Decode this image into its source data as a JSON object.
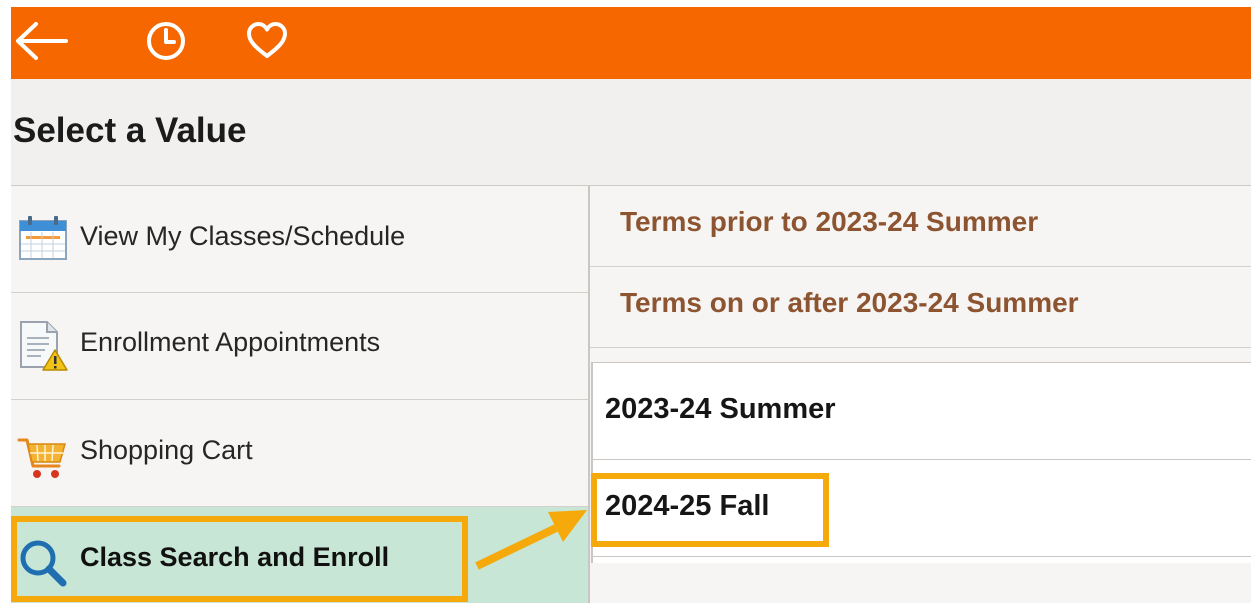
{
  "header": {
    "title": "Select a Value"
  },
  "toolbar": {
    "icons": [
      "back-arrow-icon",
      "history-clock-icon",
      "favorites-heart-icon"
    ]
  },
  "nav": {
    "items": [
      {
        "label": "View My Classes/Schedule",
        "icon": "calendar-icon"
      },
      {
        "label": "Enrollment Appointments",
        "icon": "document-warning-icon"
      },
      {
        "label": "Shopping Cart",
        "icon": "shopping-cart-icon"
      },
      {
        "label": "Class Search and Enroll",
        "icon": "magnifier-search-icon",
        "selected": true
      }
    ]
  },
  "terms": {
    "groups": [
      {
        "label": "Terms prior to 2023-24 Summer"
      },
      {
        "label": "Terms on or after 2023-24 Summer"
      }
    ],
    "items": [
      {
        "label": "2023-24 Summer"
      },
      {
        "label": "2024-25 Fall",
        "highlighted": true
      }
    ]
  },
  "colors": {
    "topbar": "#f66700",
    "active_nav": "#c7e6d6",
    "group_text": "#8c5431",
    "annotation": "#f5a90a"
  }
}
